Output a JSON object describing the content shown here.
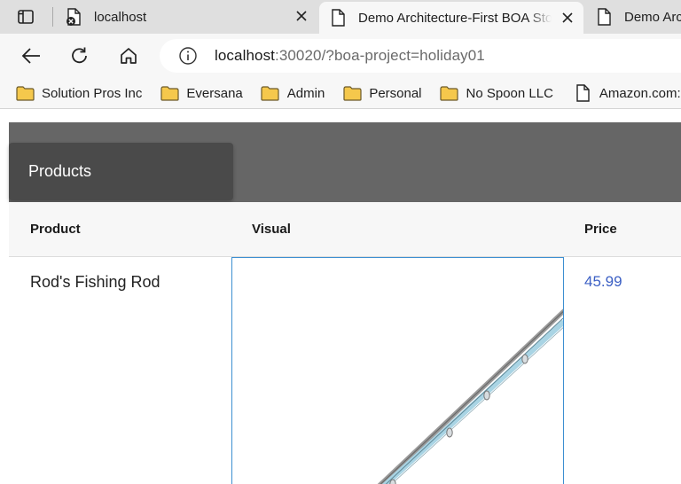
{
  "browser": {
    "tabs": [
      {
        "title": "localhost",
        "icon": "tab-favicon-blocked-icon"
      },
      {
        "title": "Demo Architecture-First BOA Store",
        "icon": "page-icon",
        "active": true
      },
      {
        "title": "Demo Architecture-First BOA Store",
        "icon": "page-icon"
      }
    ],
    "address": {
      "host": "localhost",
      "rest": ":30020/?boa-project=holiday01"
    },
    "bookmarks": [
      {
        "label": "Solution Pros Inc",
        "icon": "folder-icon"
      },
      {
        "label": "Eversana",
        "icon": "folder-icon"
      },
      {
        "label": "Admin",
        "icon": "folder-icon"
      },
      {
        "label": "Personal",
        "icon": "folder-icon"
      },
      {
        "label": "No Spoon LLC",
        "icon": "folder-icon"
      },
      {
        "label": "Amazon.com: Prime Video",
        "icon": "page-icon"
      }
    ]
  },
  "app": {
    "menu": {
      "label": "Products"
    },
    "table": {
      "headers": {
        "product": "Product",
        "visual": "Visual",
        "price": "Price"
      },
      "rows": [
        {
          "product": "Rod's Fishing Rod",
          "visual": "fishing-rod-image",
          "price": "45.99"
        }
      ]
    },
    "colors": {
      "header_bg": "#666666",
      "menu_card_bg": "#4a4a4a",
      "price_link": "#3b5fc4",
      "visual_border": "#3d8fd1",
      "folder": "#f5c84c"
    }
  }
}
